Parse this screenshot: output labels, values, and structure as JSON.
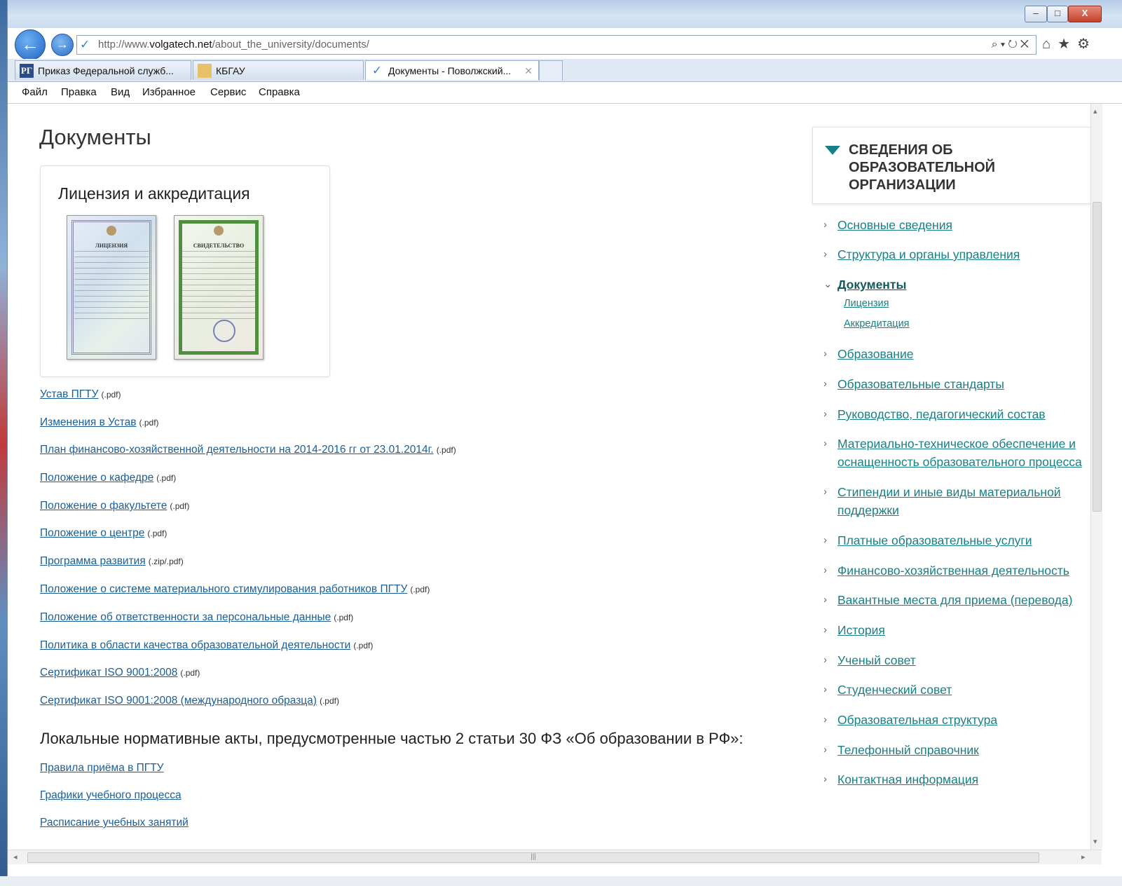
{
  "browser": {
    "address": {
      "prefix": "http://www.",
      "domain": "volgatech.net",
      "path": "/about_the_university/documents/"
    },
    "tabs": [
      {
        "label": "Приказ Федеральной служб...",
        "icon": "rg-icon",
        "icon_text": "РГ"
      },
      {
        "label": "КБГАУ",
        "icon": "kgau-icon",
        "icon_text": ""
      },
      {
        "label": "Документы - Поволжский...",
        "icon": "doc-icon",
        "icon_text": "✓"
      }
    ],
    "menu": [
      "Файл",
      "Правка",
      "Вид",
      "Избранное",
      "Сервис",
      "Справка"
    ]
  },
  "page": {
    "title": "Документы",
    "license_box_title": "Лицензия и аккредитация",
    "cert1_head": "ЛИЦЕНЗИЯ",
    "cert2_head": "СВИДЕТЕЛЬСТВО",
    "documents": [
      {
        "label": "Устав ПГТУ",
        "ext": "(.pdf)"
      },
      {
        "label": "Изменения в Устав",
        "ext": "(.pdf)"
      },
      {
        "label": "План финансово-хозяйственной деятельности на 2014-2016 гг от 23.01.2014г.",
        "ext": "(.pdf)"
      },
      {
        "label": "Положение о кафедре",
        "ext": "(.pdf)"
      },
      {
        "label": "Положение о факультете",
        "ext": "(.pdf)"
      },
      {
        "label": "Положение о центре",
        "ext": "(.pdf)"
      },
      {
        "label": "Программа развития",
        "ext": "(.zip/.pdf)"
      },
      {
        "label": "Положение о системе материального стимулирования работников ПГТУ",
        "ext": "(.pdf)"
      },
      {
        "label": "Положение об ответственности за персональные данные",
        "ext": "(.pdf)"
      },
      {
        "label": "Политика в области качества образовательной деятельности",
        "ext": "(.pdf)"
      },
      {
        "label": "Сертификат ISO 9001:2008",
        "ext": "(.pdf)"
      },
      {
        "label": "Сертификат ISO 9001:2008 (международного образца)",
        "ext": "(.pdf)"
      }
    ],
    "acts_heading": "Локальные нормативные акты, предусмотренные частью 2 статьи 30 ФЗ «Об образовании в РФ»:",
    "acts": [
      {
        "label": "Правила приёма в ПГТУ"
      },
      {
        "label": "Графики учебного процесса"
      },
      {
        "label": "Расписание учебных занятий"
      }
    ]
  },
  "sidebar": {
    "title": "СВЕДЕНИЯ ОБ ОБРАЗОВАТЕЛЬНОЙ ОРГАНИЗАЦИИ",
    "items": [
      {
        "label": "Основные сведения"
      },
      {
        "label": "Структура и органы управления"
      },
      {
        "label": "Документы",
        "current": true,
        "expanded": true
      },
      {
        "label": "Образование"
      },
      {
        "label": "Образовательные стандарты"
      },
      {
        "label": "Руководство, педагогический состав"
      },
      {
        "label": "Материально-техническое обеспечение и оснащенность образовательного процесса"
      },
      {
        "label": "Стипендии и иные виды материальной поддержки"
      },
      {
        "label": "Платные образовательные услуги"
      },
      {
        "label": "Финансово-хозяйственная деятельность"
      },
      {
        "label": "Вакантные места для приема (перевода)"
      },
      {
        "label": "История"
      },
      {
        "label": "Ученый совет"
      },
      {
        "label": "Студенческий совет"
      },
      {
        "label": "Образовательная структура"
      },
      {
        "label": "Телефонный справочник"
      },
      {
        "label": "Контактная информация"
      }
    ],
    "subitems": [
      {
        "label": "Лицензия"
      },
      {
        "label": "Аккредитация"
      }
    ]
  },
  "colors": {
    "link": "#1a5e9a",
    "sidebar_link": "#187f86",
    "accent": "#187f86"
  }
}
